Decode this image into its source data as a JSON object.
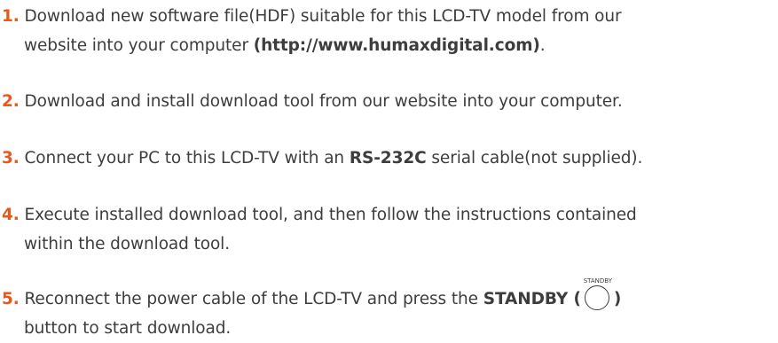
{
  "steps": [
    {
      "number": "1.",
      "text_a": " Download new software file(HDF) suitable for this LCD-TV model from our",
      "text_b": "website into your computer ",
      "bold": "(http://www.humaxdigital.com)",
      "text_c": "."
    },
    {
      "number": "2.",
      "text_a": " Download and install download tool from our website into your computer."
    },
    {
      "number": "3.",
      "text_a": " Connect your PC to this LCD-TV with an ",
      "bold": "RS-232C",
      "text_c": " serial cable(not supplied)."
    },
    {
      "number": "4.",
      "text_a": " Execute installed download tool, and then follow the instructions contained",
      "text_b": "within the download tool."
    },
    {
      "number": "5.",
      "text_a": " Reconnect the power cable of the LCD-TV and press the ",
      "bold": "STANDBY (",
      "button_caption": "STANDBY",
      "bold_close": ")",
      "text_b": "button to start download."
    }
  ],
  "colors": {
    "step_number": "#e8571e",
    "body_text": "#3d3d3d"
  }
}
